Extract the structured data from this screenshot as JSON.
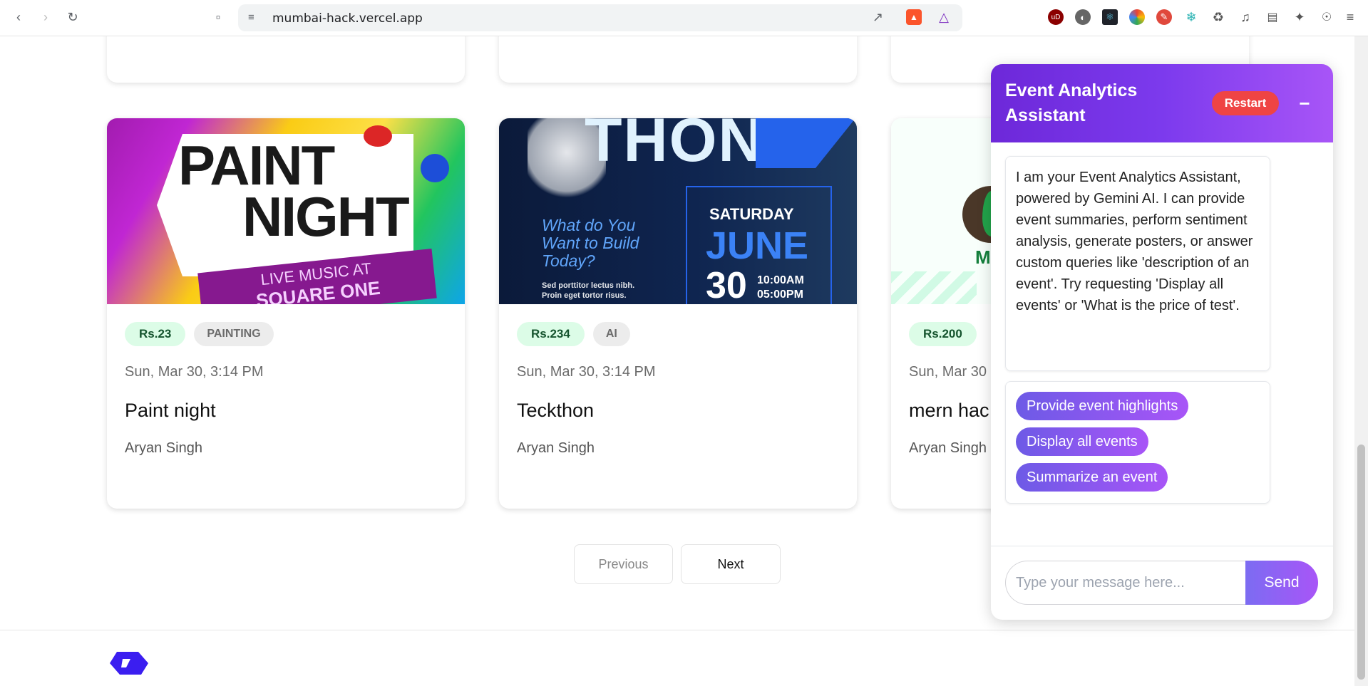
{
  "browser": {
    "url": "mumbai-hack.vercel.app"
  },
  "cards": [
    {
      "price": "Rs.23",
      "category": "PAINTING",
      "date": "Sun, Mar 30, 3:14 PM",
      "title": "Paint night",
      "organizer": "Aryan Singh",
      "image_text": [
        "PAINT",
        "NIGHT",
        "LIVE MUSIC AT",
        "SQUARE ONE"
      ]
    },
    {
      "price": "Rs.234",
      "category": "AI",
      "date": "Sun, Mar 30, 3:14 PM",
      "title": "Teckthon",
      "organizer": "Aryan Singh",
      "image_text": [
        "THON",
        "What do You",
        "Want to Build",
        "Today?",
        "Sed porttitor lectus nibh.",
        "Proin eget tortor risus.",
        "SATURDAY",
        "JUNE",
        "30",
        "10:00AM",
        "05:00PM"
      ]
    },
    {
      "price": "Rs.200",
      "category": "",
      "date": "Sun, Mar 30",
      "title": "mern hac",
      "organizer": "Aryan Singh",
      "image_text": [
        "M"
      ]
    }
  ],
  "pagination": {
    "previous": "Previous",
    "next": "Next"
  },
  "chat": {
    "title": "Event Analytics Assistant",
    "restart": "Restart",
    "minimize": "−",
    "message": "I am your Event Analytics Assistant, powered by Gemini AI. I can provide event summaries, perform sentiment analysis, generate posters, or answer custom queries like 'description of an event'. Try requesting 'Display all events' or 'What is the price of test'.",
    "suggestions": [
      "Provide event highlights",
      "Display all events",
      "Summarize an event"
    ],
    "input_placeholder": "Type your message here...",
    "send": "Send"
  },
  "colors": {
    "accent": "#7c3aed",
    "restart": "#ef4444",
    "price_badge": "#dcfce7",
    "logo": "#3b1ef0"
  }
}
